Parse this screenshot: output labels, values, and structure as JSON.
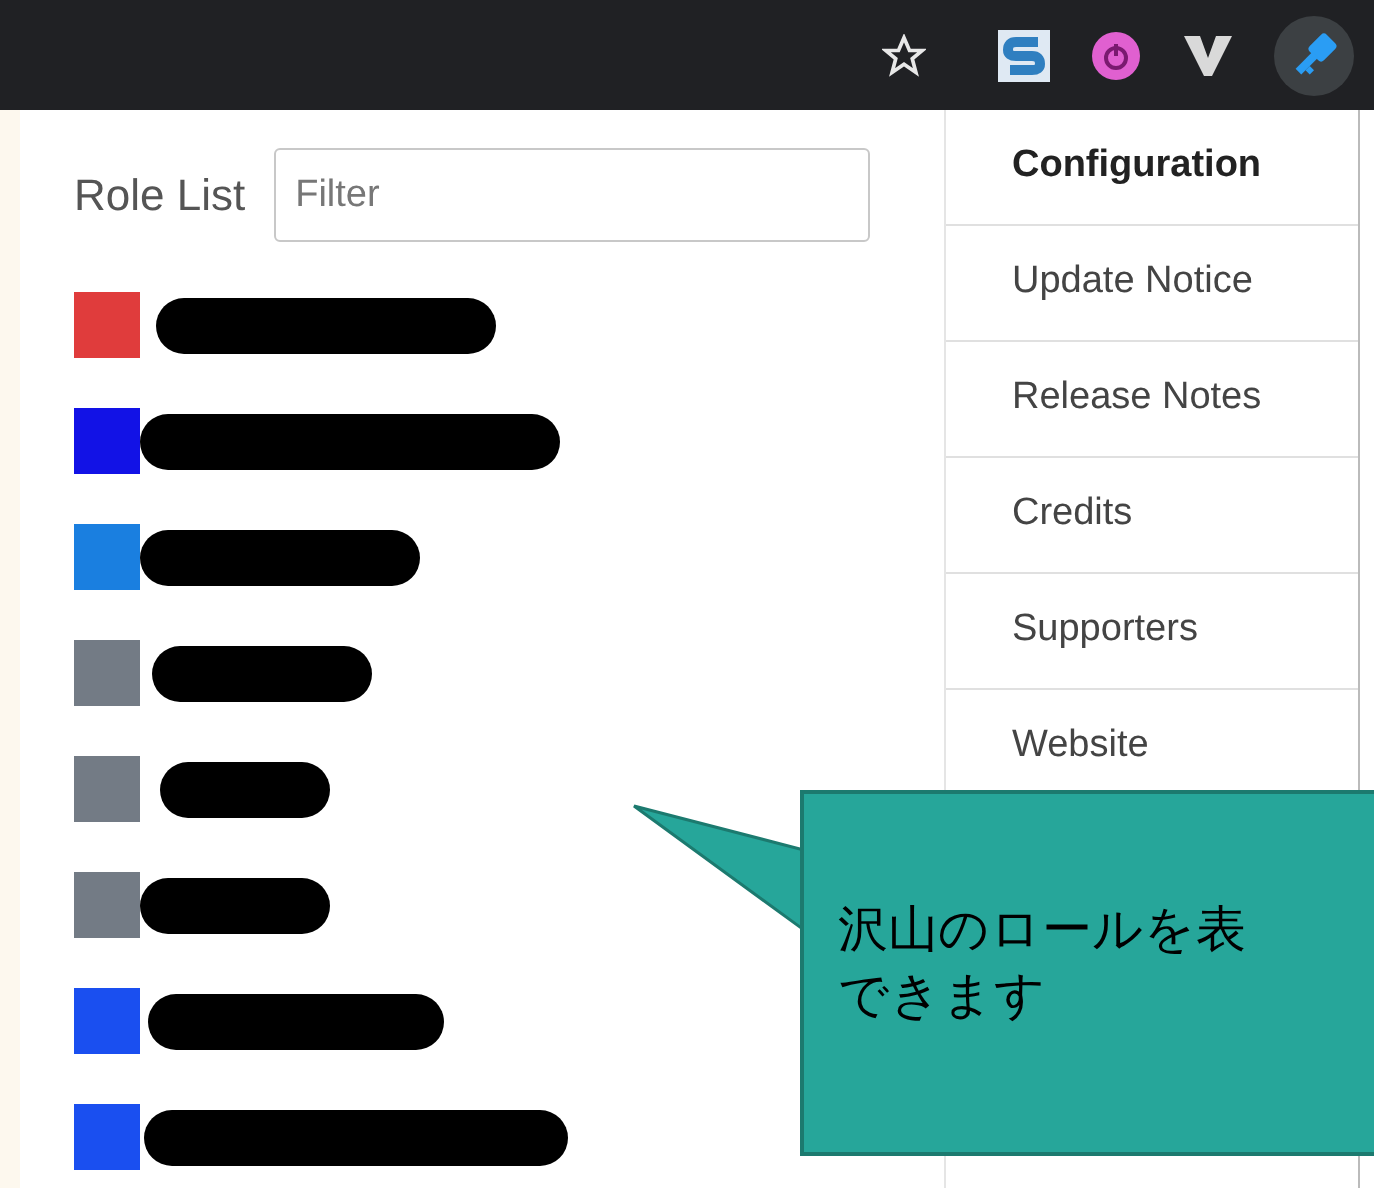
{
  "toolbar": {
    "icons": [
      {
        "kind": "star"
      },
      {
        "kind": "s"
      },
      {
        "kind": "power"
      },
      {
        "kind": "v"
      },
      {
        "kind": "key"
      }
    ]
  },
  "role_list": {
    "label": "Role List",
    "filter": {
      "placeholder": "Filter"
    },
    "roles": [
      {
        "color": "#e03c3c"
      },
      {
        "color": "#1212e6"
      },
      {
        "color": "#1a7fe0"
      },
      {
        "color": "#737b85"
      },
      {
        "color": "#737b85"
      },
      {
        "color": "#737b85"
      },
      {
        "color": "#1a4ff0"
      },
      {
        "color": "#1a4ff0"
      }
    ]
  },
  "menu": [
    {
      "label": "Configuration",
      "selected": true
    },
    {
      "label": "Update Notice",
      "selected": false
    },
    {
      "label": "Release Notes",
      "selected": false
    },
    {
      "label": "Credits",
      "selected": false
    },
    {
      "label": "Supporters",
      "selected": false
    },
    {
      "label": "Website",
      "selected": false
    }
  ],
  "callout": {
    "lines": [
      "沢山のロールを表",
      "できます"
    ]
  }
}
